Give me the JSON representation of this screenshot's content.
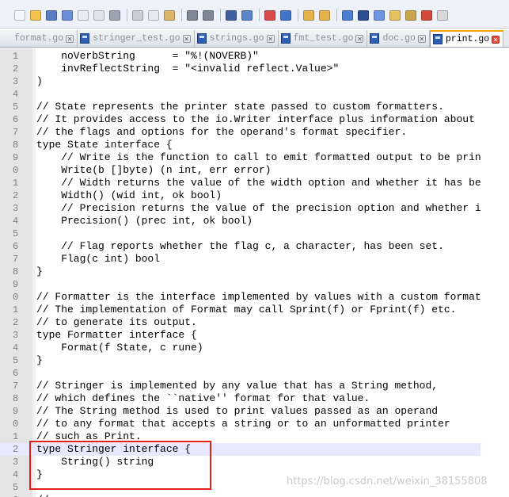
{
  "tabs": [
    {
      "label": "format.go",
      "active": false
    },
    {
      "label": "stringer_test.go",
      "active": false
    },
    {
      "label": "strings.go",
      "active": false
    },
    {
      "label": "fmt_test.go",
      "active": false
    },
    {
      "label": "doc.go",
      "active": false
    },
    {
      "label": "print.go",
      "active": true
    }
  ],
  "editor": {
    "lines": [
      {
        "num": "1",
        "text": "    noVerbString      = \"%!(NOVERB)\""
      },
      {
        "num": "2",
        "text": "    invReflectString  = \"<invalid reflect.Value>\""
      },
      {
        "num": "3",
        "text": ")"
      },
      {
        "num": "4",
        "text": ""
      },
      {
        "num": "5",
        "text": "// State represents the printer state passed to custom formatters."
      },
      {
        "num": "6",
        "text": "// It provides access to the io.Writer interface plus information about"
      },
      {
        "num": "7",
        "text": "// the flags and options for the operand's format specifier."
      },
      {
        "num": "8",
        "text": "type State interface {"
      },
      {
        "num": "9",
        "text": "    // Write is the function to call to emit formatted output to be printed."
      },
      {
        "num": "0",
        "text": "    Write(b []byte) (n int, err error)"
      },
      {
        "num": "1",
        "text": "    // Width returns the value of the width option and whether it has been set."
      },
      {
        "num": "2",
        "text": "    Width() (wid int, ok bool)"
      },
      {
        "num": "3",
        "text": "    // Precision returns the value of the precision option and whether it has been set."
      },
      {
        "num": "4",
        "text": "    Precision() (prec int, ok bool)"
      },
      {
        "num": "5",
        "text": ""
      },
      {
        "num": "6",
        "text": "    // Flag reports whether the flag c, a character, has been set."
      },
      {
        "num": "7",
        "text": "    Flag(c int) bool"
      },
      {
        "num": "8",
        "text": "}"
      },
      {
        "num": "9",
        "text": ""
      },
      {
        "num": "0",
        "text": "// Formatter is the interface implemented by values with a custom formatter."
      },
      {
        "num": "1",
        "text": "// The implementation of Format may call Sprint(f) or Fprint(f) etc."
      },
      {
        "num": "2",
        "text": "// to generate its output."
      },
      {
        "num": "3",
        "text": "type Formatter interface {"
      },
      {
        "num": "4",
        "text": "    Format(f State, c rune)"
      },
      {
        "num": "5",
        "text": "}"
      },
      {
        "num": "6",
        "text": ""
      },
      {
        "num": "7",
        "text": "// Stringer is implemented by any value that has a String method,"
      },
      {
        "num": "8",
        "text": "// which defines the ``native'' format for that value."
      },
      {
        "num": "9",
        "text": "// The String method is used to print values passed as an operand"
      },
      {
        "num": "0",
        "text": "// to any format that accepts a string or to an unformatted printer"
      },
      {
        "num": "1",
        "text": "// such as Print."
      },
      {
        "num": "2",
        "text": "type Stringer interface {",
        "highlighted": true
      },
      {
        "num": "3",
        "text": "    String() string"
      },
      {
        "num": "4",
        "text": "}"
      },
      {
        "num": "5",
        "text": ""
      },
      {
        "num": "6",
        "text": "//"
      }
    ]
  },
  "watermark": "https://blog.csdn.net/weixin_38155808",
  "colors": {
    "highlight_line": "#e8e8ff",
    "annotation_box": "#e0201c",
    "active_tab_accent": "#f5a200"
  }
}
